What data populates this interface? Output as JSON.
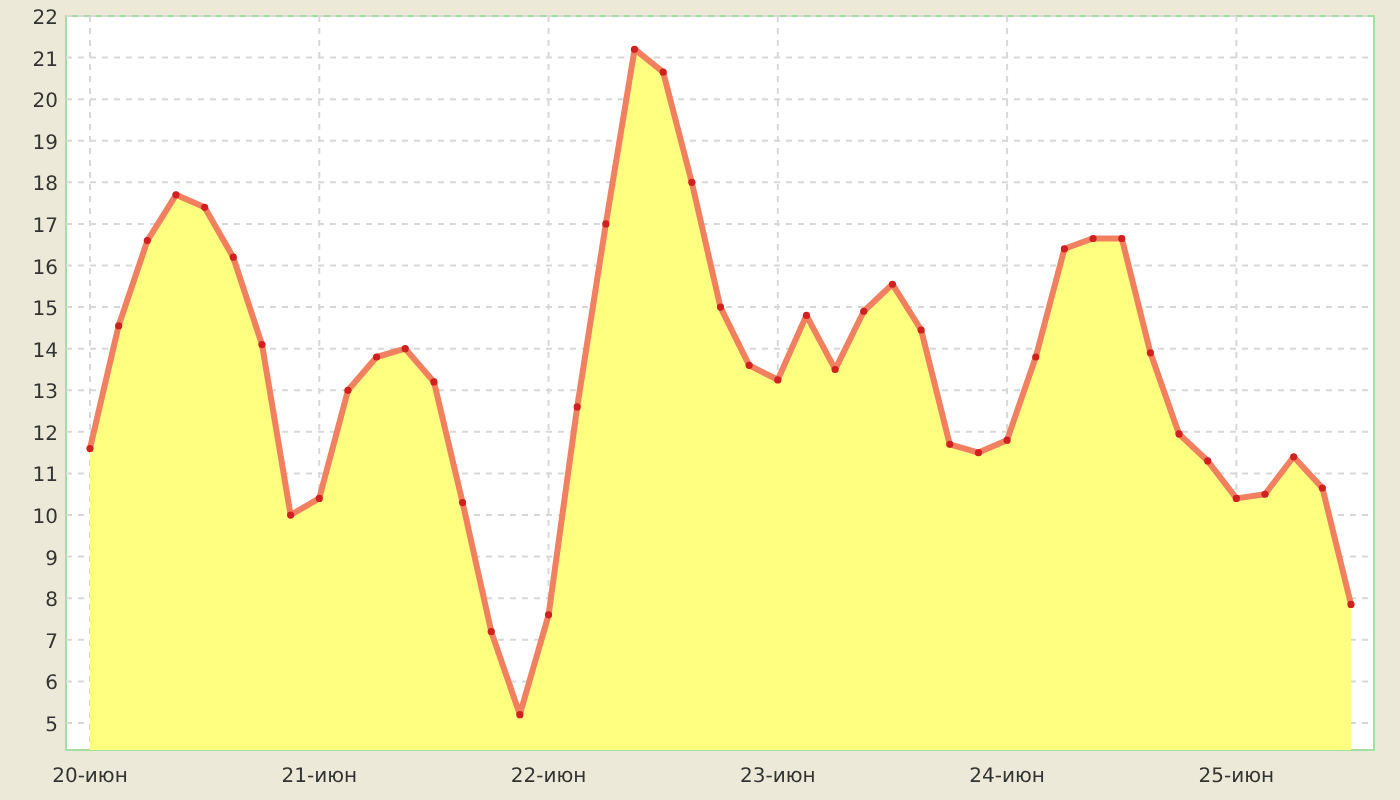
{
  "chart": {
    "chart_data": {
      "type": "area",
      "grid": true,
      "categories": [
        "20-июн",
        null,
        null,
        null,
        null,
        null,
        null,
        null,
        "21-июн",
        null,
        null,
        null,
        null,
        null,
        null,
        null,
        "22-июн",
        null,
        null,
        null,
        null,
        null,
        null,
        null,
        "23-июн",
        null,
        null,
        null,
        null,
        null,
        null,
        null,
        "24-июн",
        null,
        null,
        null,
        null,
        null,
        null,
        null,
        "25-июн",
        null,
        null,
        null,
        null
      ],
      "series": [
        {
          "color": "#f08060",
          "values": [
            11.6,
            14.55,
            16.6,
            17.7,
            17.4,
            16.2,
            14.1,
            10.0,
            10.4,
            13.0,
            13.8,
            14.0,
            13.2,
            10.3,
            7.2,
            5.2,
            7.6,
            12.6,
            17.0,
            21.2,
            20.65,
            18.0,
            15.0,
            13.6,
            13.25,
            14.8,
            13.5,
            14.9,
            15.55,
            14.45,
            11.7,
            11.5,
            11.8,
            13.8,
            16.4,
            16.65,
            16.65,
            13.9,
            11.95,
            11.3,
            10.4,
            10.5,
            11.4,
            10.65,
            7.85
          ]
        }
      ],
      "ylim": [
        4.35,
        22
      ],
      "yticks": [
        5,
        6,
        7,
        8,
        9,
        10,
        11,
        12,
        13,
        14,
        15,
        16,
        17,
        18,
        19,
        20,
        21,
        22
      ]
    }
  }
}
